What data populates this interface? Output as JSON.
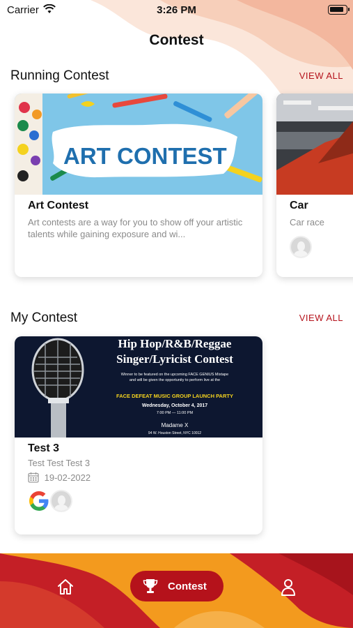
{
  "status_bar": {
    "carrier": "Carrier",
    "time": "3:26 PM"
  },
  "page": {
    "title": "Contest"
  },
  "running": {
    "section_title": "Running Contest",
    "view_all": "VIEW ALL",
    "cards": [
      {
        "image_text": "ART CONTEST",
        "title": "Art Contest",
        "description": "Art contests are a way for you to show off your artistic talents while gaining exposure and wi..."
      },
      {
        "title": "Car",
        "description": "Car race"
      }
    ]
  },
  "mine": {
    "section_title": "My Contest",
    "view_all": "VIEW ALL",
    "cards": [
      {
        "poster": {
          "line1": "Hip Hop/R&B/Reggae",
          "line2": "Singer/Lyricist Contest",
          "small1": "Winner to be featured on the upcoming FACE GENIUS Mixtape",
          "small2": "and will be given the opportunity to perform live at the",
          "event": "FACE DEFEAT MUSIC GROUP LAUNCH PARTY",
          "date": "Wednesday, October 4, 2017",
          "time": "7:00 PM — 11:00 PM",
          "venue": "Madame X",
          "address": "94 W. Houston Street, NYC 10012"
        },
        "title": "Test 3",
        "description": "Test Test Test 3",
        "date": "19-02-2022"
      }
    ]
  },
  "tabbar": {
    "contest_label": "Contest",
    "active_color": "#b5121b"
  },
  "colors": {
    "accent": "#b5121b",
    "orange": "#f39a1e",
    "peach": "#f8d9c7"
  },
  "icons": [
    "wifi-icon",
    "battery-icon",
    "calendar-icon",
    "google-icon",
    "home-icon",
    "trophy-icon",
    "user-icon",
    "avatar-icon"
  ]
}
